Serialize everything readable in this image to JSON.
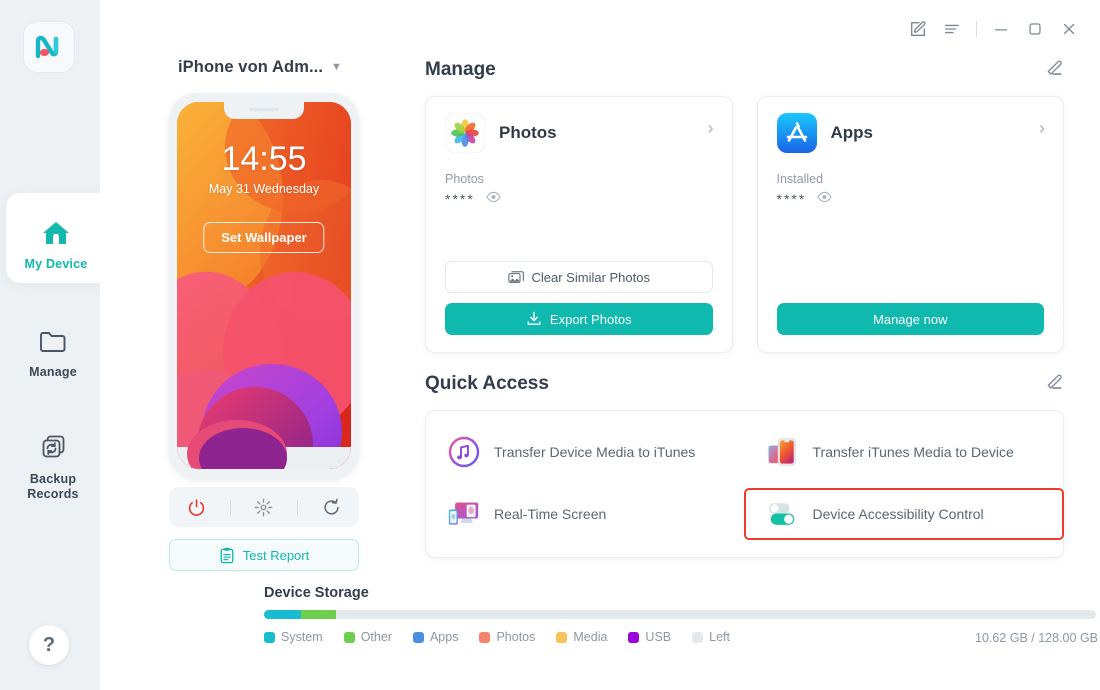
{
  "app": {
    "logo_name": "mobitrix-logo",
    "accent": "#0fb9ad"
  },
  "titlebar": {
    "buttons": [
      {
        "name": "feedback-icon",
        "label": "Feedback"
      },
      {
        "name": "menu-icon",
        "label": "Menu"
      },
      {
        "name": "minimize-icon",
        "label": "Minimize"
      },
      {
        "name": "maximize-icon",
        "label": "Maximize"
      },
      {
        "name": "close-icon",
        "label": "Close"
      }
    ]
  },
  "sidebar": {
    "items": [
      {
        "label": "My Device",
        "icon": "home-icon",
        "active": true
      },
      {
        "label": "Manage",
        "icon": "folder-icon",
        "active": false
      },
      {
        "label": "Backup Records",
        "icon": "backup-sync-icon",
        "active": false
      }
    ],
    "help_label": "?"
  },
  "device": {
    "name": "iPhone von Adm...",
    "lockscreen": {
      "time": "14:55",
      "date": "May 31 Wednesday",
      "set_wallpaper_label": "Set Wallpaper"
    },
    "controls": [
      {
        "name": "power-icon",
        "label": "Power"
      },
      {
        "name": "brightness-icon",
        "label": "Brightness"
      },
      {
        "name": "refresh-icon",
        "label": "Refresh"
      }
    ],
    "test_report_label": "Test Report"
  },
  "manage": {
    "title": "Manage",
    "edit_label": "Edit",
    "cards": [
      {
        "title": "Photos",
        "icon": "photos-app-icon",
        "sub_label": "Photos",
        "value": "****",
        "eye_icon": "eye-icon",
        "chevron": "›",
        "buttons": [
          {
            "label": "Clear Similar Photos",
            "style": "ghost",
            "icon": "photo-stack-icon"
          },
          {
            "label": "Export Photos",
            "style": "primary",
            "icon": "download-icon"
          }
        ]
      },
      {
        "title": "Apps",
        "icon": "appstore-app-icon",
        "sub_label": "Installed",
        "value": "****",
        "eye_icon": "eye-icon",
        "chevron": "›",
        "buttons": [
          {
            "label": "Manage now",
            "style": "primary",
            "icon": ""
          }
        ]
      }
    ]
  },
  "quick_access": {
    "title": "Quick Access",
    "edit_label": "Edit",
    "items": [
      {
        "label": "Transfer Device Media to iTunes",
        "icon": "itunes-icon",
        "highlight": false
      },
      {
        "label": "Transfer iTunes Media to Device",
        "icon": "phone-media-icon",
        "highlight": false
      },
      {
        "label": "Real-Time Screen",
        "icon": "screen-mirror-icon",
        "highlight": false
      },
      {
        "label": "Device Accessibility Control",
        "icon": "toggle-switch-icon",
        "highlight": true
      }
    ]
  },
  "storage": {
    "title": "Device Storage",
    "amount": "10.62 GB / 128.00 GB",
    "clean_icon": "broom-icon",
    "segments": [
      {
        "label": "System",
        "color": "#18bccf",
        "percent": 4.5
      },
      {
        "label": "Other",
        "color": "#6ece4e",
        "percent": 4.2
      },
      {
        "label": "Apps",
        "color": "#4a90e2",
        "percent": 0
      },
      {
        "label": "Photos",
        "color": "#f5836a",
        "percent": 0
      },
      {
        "label": "Media",
        "color": "#f7c35b",
        "percent": 0
      },
      {
        "label": "USB",
        "color": "#9b00d8",
        "percent": 0
      },
      {
        "label": "Left",
        "color": "#e6e9ec",
        "percent": 91.3
      }
    ]
  }
}
